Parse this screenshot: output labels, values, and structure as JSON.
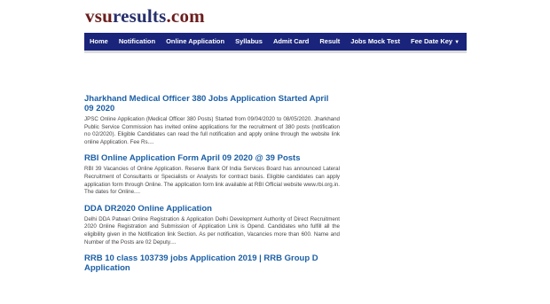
{
  "logo": {
    "part1": "vsu",
    "part2": "results",
    "part3": ".com"
  },
  "nav": [
    {
      "label": "Home"
    },
    {
      "label": "Notification"
    },
    {
      "label": "Online Application"
    },
    {
      "label": "Syllabus"
    },
    {
      "label": "Admit Card"
    },
    {
      "label": "Result"
    },
    {
      "label": "Jobs Mock Test"
    },
    {
      "label": "Fee Date Key",
      "caret": "▼"
    }
  ],
  "posts": [
    {
      "title": "Jharkhand Medical Officer 380 Jobs Application Started April 09 2020",
      "excerpt": "JPSC Online Application (Medical Officer 380 Posts) Started from 09/04/2020 to 08/05/2020. Jharkhand Public Service Commission has invited online applications for the recruitment of 380 posts (notification no 02/2020). Eligible Candidates can read the full notification and apply online through the website link online Application. Fee Rs...."
    },
    {
      "title": "RBI Online Application Form April 09 2020 @ 39 Posts",
      "excerpt": "RBI 39 Vacancies of Online Application.     Reserve Bank Of India Services Board has announced Lateral Recruitment of Consultants or Specialists or Analysts for contract basis. Eligible candidates can apply application form through Online. The application form link available at RBI Official website www.rbi.org.in. The dates for Online...."
    },
    {
      "title": "DDA DR2020 Online Application",
      "excerpt": "Delhi DDA Patwari Online Registration & Application Delhi Development Authority of Direct Recruitment 2020 Online Registration and Submission of Application Link is Opend. Candidates who fulfill all the eligibility given in the Notification link Section. As per notification, Vacancies more than 600. Name and Number of the Posts are 02 Deputy...."
    },
    {
      "title": "RRB 10 class 103739 jobs Application 2019 | RRB Group D Application",
      "excerpt": ""
    }
  ]
}
